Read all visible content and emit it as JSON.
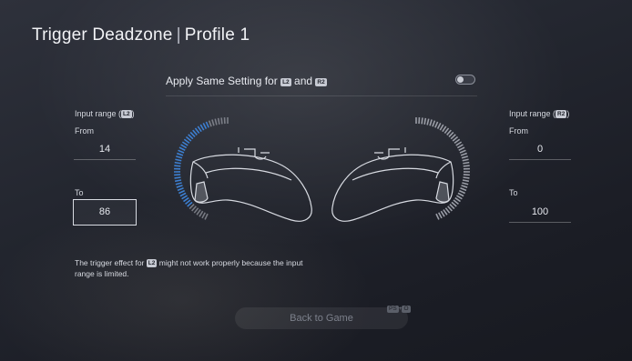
{
  "header": {
    "title": "Trigger Deadzone",
    "separator": "|",
    "profile": "Profile 1"
  },
  "apply_setting": {
    "label_prefix": "Apply Same Setting for",
    "l2_icon": "L2",
    "conjunction": "and",
    "r2_icon": "R2",
    "toggle_on": false
  },
  "left_panel": {
    "input_range_label": "Input range (",
    "input_range_icon": "L2",
    "input_range_close": ")",
    "from_label": "From",
    "from_value": "14",
    "to_label": "To",
    "to_value": "86",
    "deadzone_fraction_from": 0.14,
    "deadzone_fraction_to": 0.86
  },
  "right_panel": {
    "input_range_label": "Input range (",
    "input_range_icon": "R2",
    "input_range_close": ")",
    "from_label": "From",
    "from_value": "0",
    "to_label": "To",
    "to_value": "100",
    "deadzone_fraction_from": 0.0,
    "deadzone_fraction_to": 1.0
  },
  "warning": {
    "prefix": "The trigger effect for",
    "icon": "L2",
    "suffix": "might not work properly because the input range is limited."
  },
  "footer": {
    "back_button": "Back to Game",
    "shortcut_key1": "PS",
    "shortcut_plus": "+",
    "shortcut_key2": "O"
  },
  "colors": {
    "accent_blue": "#3d7fd0",
    "arc_gray": "#9a9da6"
  }
}
